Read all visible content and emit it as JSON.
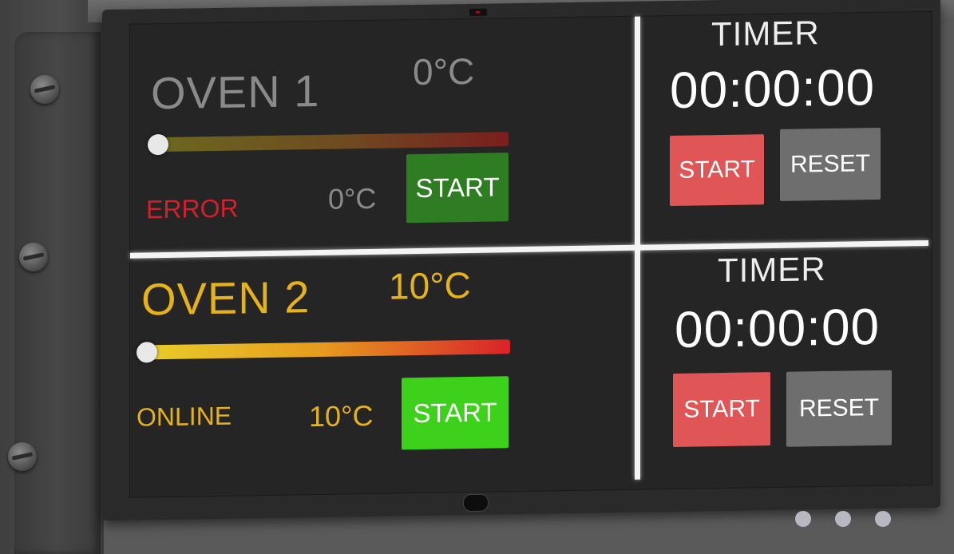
{
  "oven1": {
    "title": "OVEN 1",
    "target_temp": "0°C",
    "current_temp": "0°C",
    "status": "ERROR",
    "start_label": "START",
    "slider_level": 0,
    "title_color": "#8a8a8a",
    "status_color": "#d4202a",
    "button_color": "#2e7d22"
  },
  "oven2": {
    "title": "OVEN 2",
    "target_temp": "10°C",
    "current_temp": "10°C",
    "status": "ONLINE",
    "start_label": "START",
    "slider_level": 0,
    "title_color": "#e6b21a",
    "status_color": "#e6b21a",
    "button_color": "#3dd11c"
  },
  "timer1": {
    "label": "TIMER",
    "value": "00:00:00",
    "start_label": "START",
    "reset_label": "RESET"
  },
  "timer2": {
    "label": "TIMER",
    "value": "00:00:00",
    "start_label": "START",
    "reset_label": "RESET"
  },
  "colors": {
    "timer_start": "#e05555",
    "timer_reset": "#6e6e6e",
    "divider": "#f4f4f4"
  }
}
